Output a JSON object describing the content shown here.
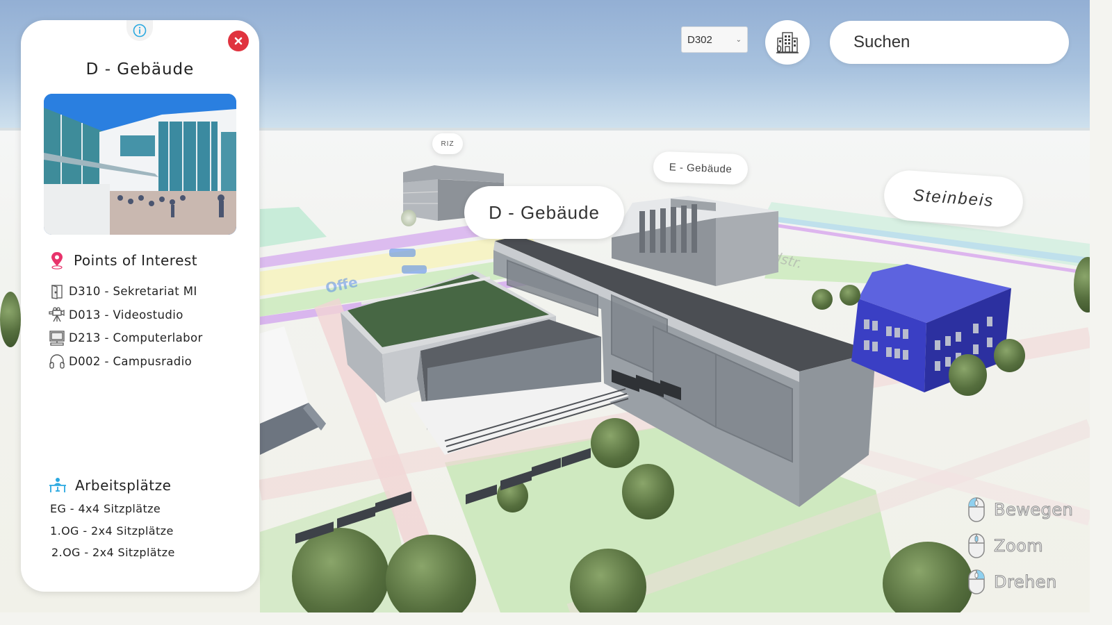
{
  "panel": {
    "title": "D - Gebäude",
    "info_icon": "info-icon",
    "close_icon": "close-icon",
    "photo_alt": "D - Gebäude Eingang",
    "poi": {
      "heading": "Points of Interest",
      "icon": "map-pin-icon",
      "items": [
        {
          "label": "D310 - Sekretariat MI",
          "icon": "door-icon"
        },
        {
          "label": "D013 - Videostudio",
          "icon": "video-camera-icon"
        },
        {
          "label": "D213 - Computerlabor",
          "icon": "computer-icon"
        },
        {
          "label": "D002 - Campusradio",
          "icon": "headphones-icon"
        }
      ]
    },
    "workspaces": {
      "heading": "Arbeitsplätze",
      "icon": "desk-icon",
      "items": [
        {
          "label": "EG - 4x4 Sitzplätze"
        },
        {
          "label": "1.OG - 2x4 Sitzplätze"
        },
        {
          "label": "2.OG - 2x4 Sitzplätze"
        }
      ]
    }
  },
  "toolbar": {
    "room_select": {
      "value": "D302"
    },
    "building_button_icon": "building-icon",
    "search": {
      "placeholder": "Suchen"
    }
  },
  "map_labels": {
    "riz": "RIZ",
    "e_building": "E - Gebäude",
    "d_building": "D - Gebäude",
    "steinbeis": "Steinbeis"
  },
  "controls": [
    {
      "label": "Bewegen",
      "icon": "mouse-left-click-icon"
    },
    {
      "label": "Zoom",
      "icon": "mouse-scroll-icon"
    },
    {
      "label": "Drehen",
      "icon": "mouse-right-click-icon"
    }
  ],
  "colors": {
    "close": "#e0333f",
    "poi_pin": "#e8336b",
    "workspace_icon": "#29a8e0",
    "info_icon": "#29a8e0",
    "steinbeis_building": "#3a3fc4",
    "green_roof": "#4a6b44"
  }
}
